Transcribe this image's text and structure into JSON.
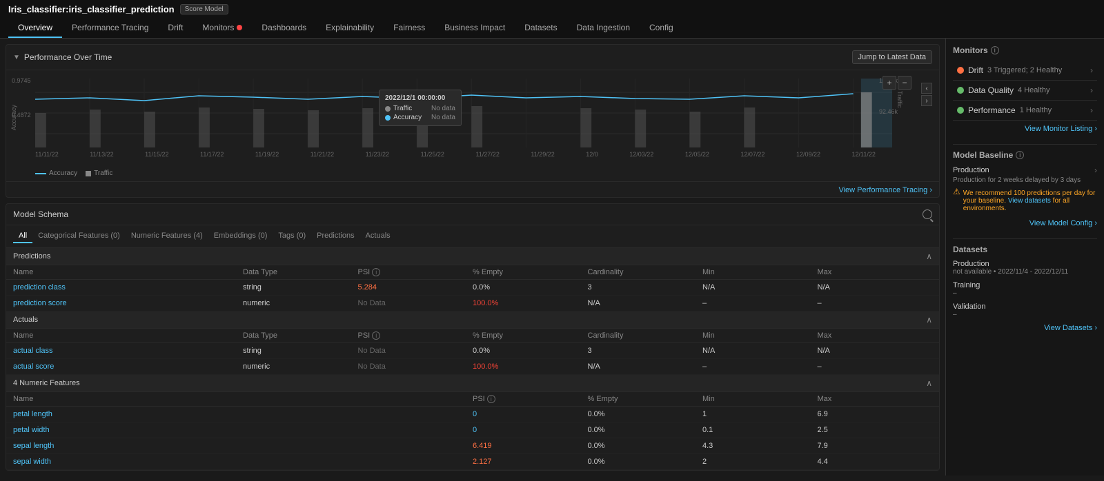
{
  "header": {
    "title": "Iris_classifier:iris_classifier_prediction",
    "badge": "Score Model",
    "tabs": [
      {
        "id": "overview",
        "label": "Overview",
        "active": true
      },
      {
        "id": "perf-tracing",
        "label": "Performance Tracing",
        "active": false
      },
      {
        "id": "drift",
        "label": "Drift",
        "active": false
      },
      {
        "id": "monitors",
        "label": "Monitors",
        "active": false,
        "warning": true
      },
      {
        "id": "dashboards",
        "label": "Dashboards",
        "active": false
      },
      {
        "id": "explainability",
        "label": "Explainability",
        "active": false
      },
      {
        "id": "fairness",
        "label": "Fairness",
        "active": false
      },
      {
        "id": "business-impact",
        "label": "Business Impact",
        "active": false
      },
      {
        "id": "datasets",
        "label": "Datasets",
        "active": false
      },
      {
        "id": "data-ingestion",
        "label": "Data Ingestion",
        "active": false
      },
      {
        "id": "config",
        "label": "Config",
        "active": false
      }
    ]
  },
  "performance_section": {
    "title": "Performance Over Time",
    "jump_button": "Jump to Latest Data",
    "legend": [
      {
        "label": "Accuracy",
        "color": "#4fc3f7"
      },
      {
        "label": "Traffic",
        "color": "#888"
      }
    ],
    "view_link": "View Performance Tracing ›",
    "y_axis_values": [
      "0.9745",
      "0.4872"
    ],
    "y_axis_right_top": "184.9k",
    "y_axis_right_bottom": "92.46k",
    "tooltip": {
      "date": "2022/12/1 00:00:00",
      "traffic_label": "Traffic",
      "traffic_value": "No data",
      "accuracy_label": "Accuracy",
      "accuracy_value": "No data"
    },
    "x_labels": [
      "11/11/22",
      "11/13/22",
      "11/15/22",
      "11/17/22",
      "11/19/22",
      "11/21/22",
      "11/23/22",
      "11/25/22",
      "11/27/22",
      "11/29/22",
      "12/0",
      "12/03/22",
      "12/05/22",
      "12/07/22",
      "12/09/22",
      "12/11/22"
    ]
  },
  "model_schema": {
    "title": "Model Schema",
    "tabs": [
      {
        "label": "All",
        "active": true
      },
      {
        "label": "Categorical Features (0)",
        "active": false
      },
      {
        "label": "Numeric Features (4)",
        "active": false
      },
      {
        "label": "Embeddings (0)",
        "active": false
      },
      {
        "label": "Tags (0)",
        "active": false
      },
      {
        "label": "Predictions",
        "active": false
      },
      {
        "label": "Actuals",
        "active": false
      }
    ],
    "predictions_section": {
      "title": "Predictions",
      "columns": [
        "Name",
        "Data Type",
        "PSI ⓘ",
        "% Empty",
        "Cardinality",
        "Min",
        "Max"
      ],
      "rows": [
        {
          "name": "prediction class",
          "data_type": "string",
          "psi": "5.284",
          "psi_color": "orange",
          "empty": "0.0%",
          "empty_color": "normal",
          "cardinality": "3",
          "min": "N/A",
          "max": "N/A"
        },
        {
          "name": "prediction score",
          "data_type": "numeric",
          "psi": "No Data",
          "psi_color": "dim",
          "empty": "100.0%",
          "empty_color": "red",
          "cardinality": "N/A",
          "min": "–",
          "max": "–"
        }
      ]
    },
    "actuals_section": {
      "title": "Actuals",
      "columns": [
        "Name",
        "Data Type",
        "PSI ⓘ",
        "% Empty",
        "Cardinality",
        "Min",
        "Max"
      ],
      "rows": [
        {
          "name": "actual class",
          "data_type": "string",
          "psi": "No Data",
          "psi_color": "dim",
          "empty": "0.0%",
          "empty_color": "normal",
          "cardinality": "3",
          "min": "N/A",
          "max": "N/A"
        },
        {
          "name": "actual score",
          "data_type": "numeric",
          "psi": "No Data",
          "psi_color": "dim",
          "empty": "100.0%",
          "empty_color": "red",
          "cardinality": "N/A",
          "min": "–",
          "max": "–"
        }
      ]
    },
    "features_section": {
      "title": "4 Numeric Features",
      "columns": [
        "Name",
        "PSI ⓘ",
        "% Empty",
        "Min",
        "Max"
      ],
      "rows": [
        {
          "name": "petal length",
          "psi": "0",
          "psi_color": "normal",
          "empty": "0.0%",
          "min": "1",
          "max": "6.9"
        },
        {
          "name": "petal width",
          "psi": "0",
          "psi_color": "normal",
          "empty": "0.0%",
          "min": "0.1",
          "max": "2.5"
        },
        {
          "name": "sepal length",
          "psi": "6.419",
          "psi_color": "orange",
          "empty": "0.0%",
          "min": "4.3",
          "max": "7.9"
        },
        {
          "name": "sepal width",
          "psi": "2.127",
          "psi_color": "orange",
          "empty": "0.0%",
          "min": "2",
          "max": "4.4"
        }
      ]
    }
  },
  "monitors_panel": {
    "title": "Monitors",
    "items": [
      {
        "name": "Drift",
        "status": "3 Triggered; 2 Healthy",
        "icon": "orange"
      },
      {
        "name": "Data Quality",
        "status": "4 Healthy",
        "icon": "green"
      },
      {
        "name": "Performance",
        "status": "1 Healthy",
        "icon": "green"
      }
    ],
    "view_link": "View Monitor Listing ›"
  },
  "model_baseline_panel": {
    "title": "Model Baseline",
    "production_label": "Production",
    "production_value": "Production for 2 weeks delayed by 3 days",
    "warning_text": "We recommend 100 predictions per day for your baseline. View datasets for all environments.",
    "view_link": "View Model Config ›"
  },
  "datasets_panel": {
    "title": "Datasets",
    "items": [
      {
        "label": "Production",
        "value": "not available • 2022/11/4 - 2022/12/11"
      },
      {
        "label": "Training",
        "value": "–"
      },
      {
        "label": "Validation",
        "value": "–"
      }
    ],
    "view_link": "View Datasets ›"
  }
}
